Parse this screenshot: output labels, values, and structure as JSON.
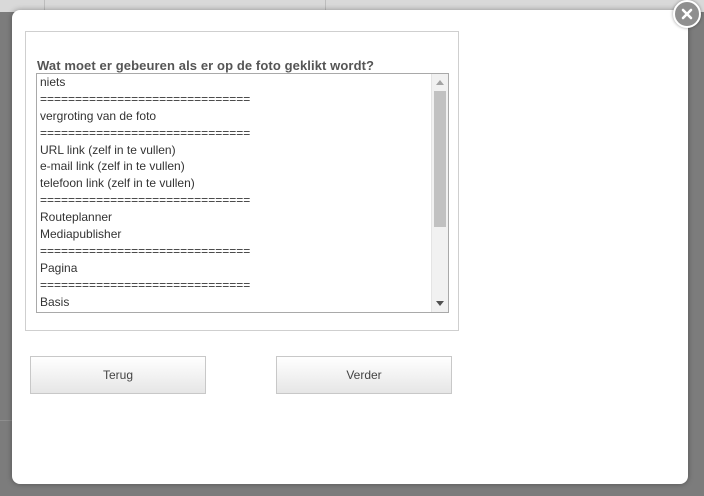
{
  "dialog": {
    "question": "Wat moet er gebeuren als er op de foto geklikt wordt?",
    "options": [
      "niets",
      "==============================",
      "vergroting van de foto",
      "==============================",
      "URL link (zelf in te vullen)",
      "e-mail link (zelf in te vullen)",
      "telefoon link (zelf in te vullen)",
      "==============================",
      "Routeplanner",
      "Mediapublisher",
      "==============================",
      "Pagina",
      "==============================",
      "Basis"
    ],
    "back_label": "Terug",
    "next_label": "Verder"
  },
  "icons": {
    "close": "close-icon",
    "scroll_up": "scroll-up-icon",
    "scroll_down": "scroll-down-icon"
  },
  "colors": {
    "overlay": "#7c7c7c",
    "modal_bg": "#ffffff",
    "close_bg": "#8f8f8f",
    "scroll_thumb": "#c1c1c1"
  }
}
